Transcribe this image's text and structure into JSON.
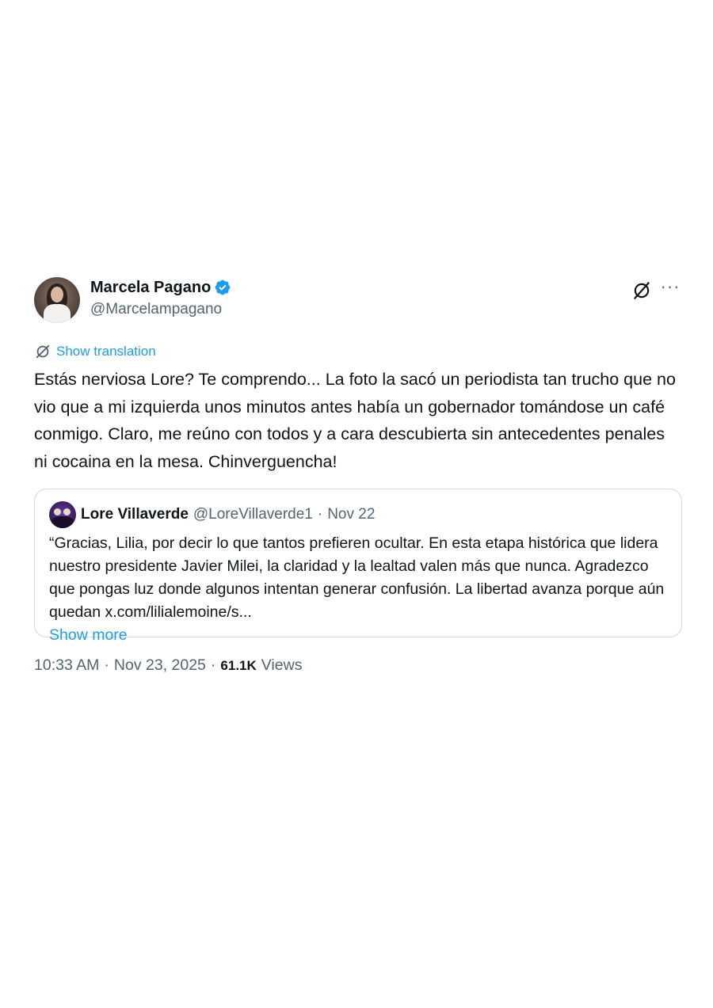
{
  "author": {
    "name": "Marcela Pagano",
    "handle": "@Marcelampagano",
    "verified_color": "#1d9bf0"
  },
  "actions": {
    "grok_icon": "grok-icon",
    "more_label": "···"
  },
  "translate": {
    "icon": "translate-icon",
    "label": "Show translation"
  },
  "tweet": {
    "text": "Estás nerviosa Lore? Te comprendo... La foto la sacó un periodista tan trucho que no vio que a mi izquierda unos minutos antes había un gobernador tomándose un café conmigo. Claro, me reúno con todos y a cara descubierta sin antecedentes penales ni cocaina en la mesa. Chinverguencha!"
  },
  "quote": {
    "name": "Lore Villaverde",
    "handle": "@LoreVillaverde1",
    "separator": "·",
    "date": "Nov 22",
    "text": "“Gracias, Lilia, por decir lo que tantos prefieren ocultar. En esta etapa histórica que lidera nuestro presidente Javier Milei, la claridad y la lealtad valen más que nunca. Agradezco que pongas luz donde algunos intentan generar confusión. La libertad avanza porque aún quedan x.com/lilialemoine/s...",
    "show_more": "Show more"
  },
  "meta": {
    "time": "10:33 AM",
    "sep1": "·",
    "date": "Nov 23, 2025",
    "sep2": "·",
    "views_count": "61.1K",
    "views_label": "Views"
  }
}
